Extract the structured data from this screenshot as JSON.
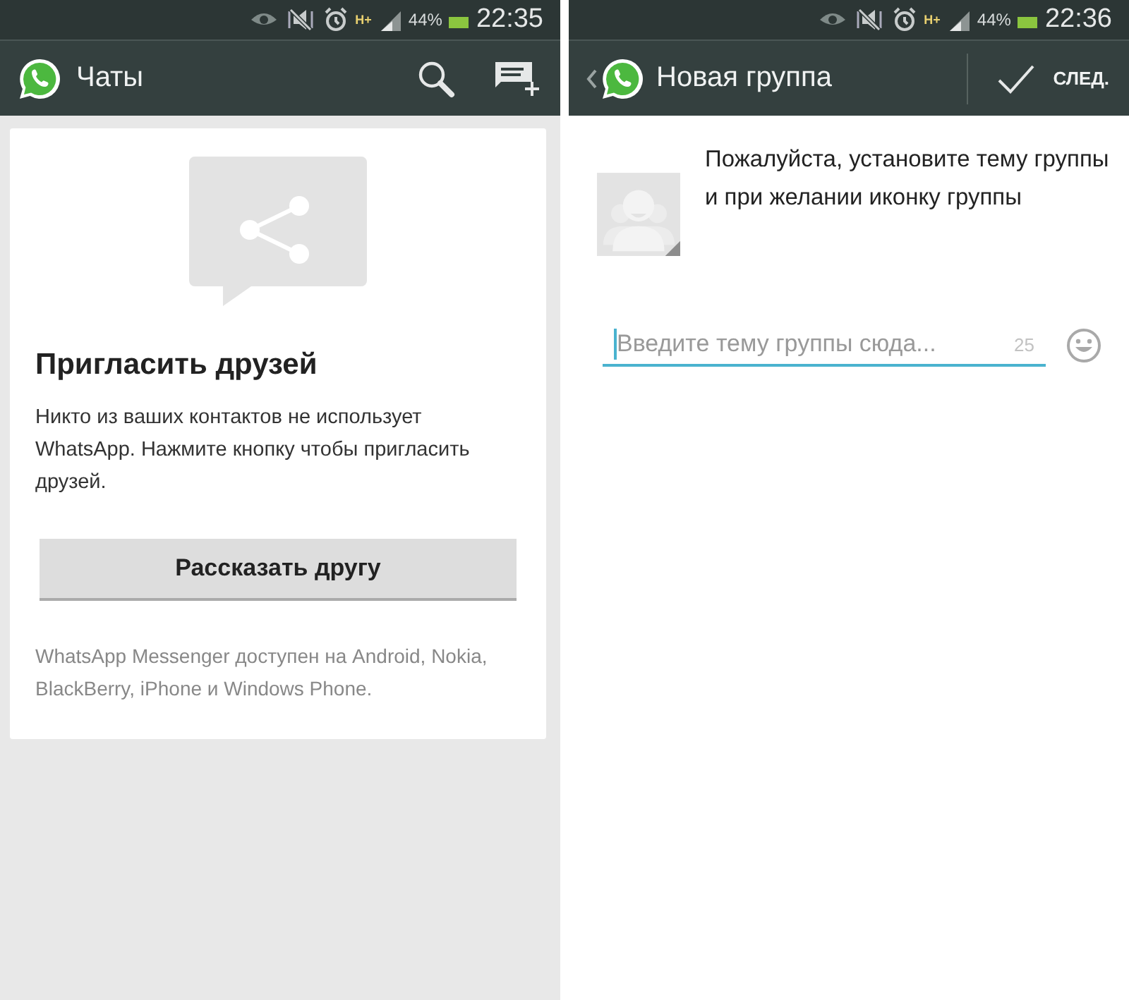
{
  "chats_screen": {
    "status_bar": {
      "network": "H+",
      "battery": "44%",
      "time": "22:35"
    },
    "app_bar": {
      "title": "Чаты"
    },
    "invite_card": {
      "title": "Пригласить друзей",
      "body": "Никто из ваших контактов не использует WhatsApp. Нажмите кнопку чтобы пригласить друзей.",
      "button": "Рассказать другу",
      "footnote": "WhatsApp Messenger доступен на Android, Nokia, BlackBerry, iPhone и Windows Phone."
    }
  },
  "new_group_screen": {
    "status_bar": {
      "network": "H+",
      "battery": "44%",
      "time": "22:36"
    },
    "app_bar": {
      "title": "Новая группа",
      "next": "СЛЕД."
    },
    "prompt": "Пожалуйста, установите тему группы и при желании иконку группы",
    "subject_field": {
      "placeholder": "Введите тему группы сюда...",
      "counter": "25"
    }
  }
}
